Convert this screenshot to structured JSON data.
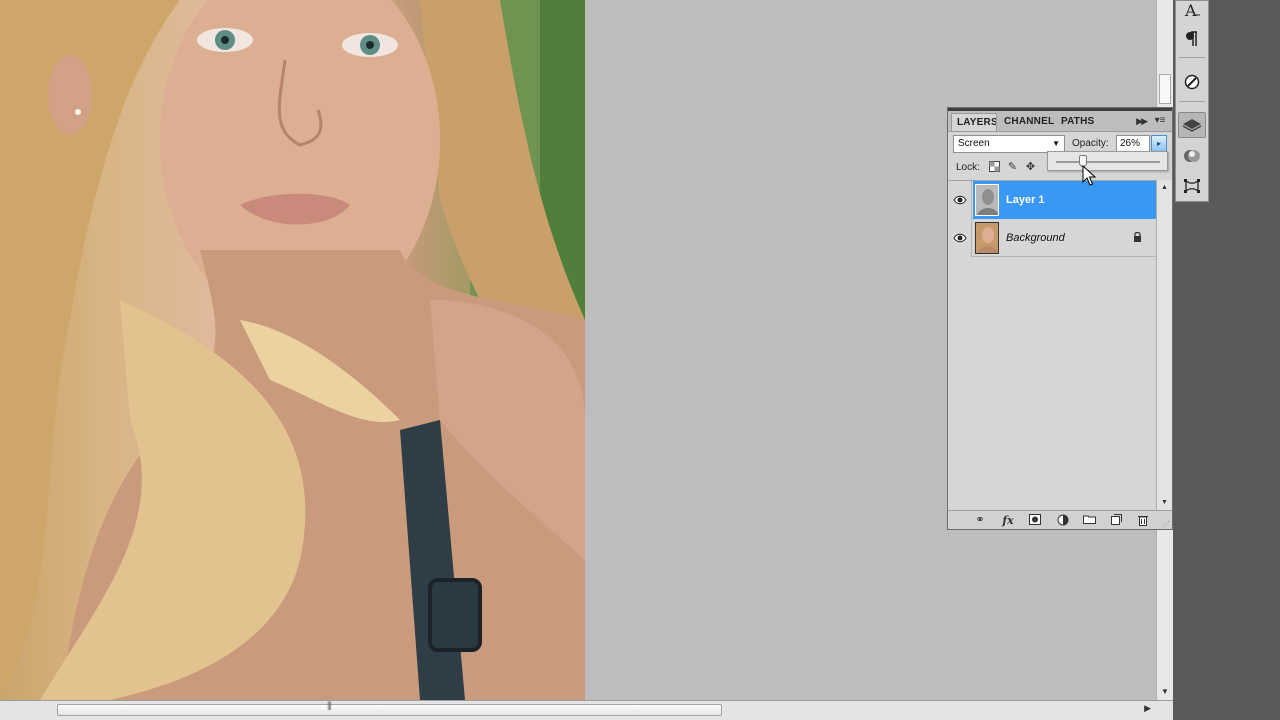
{
  "panel": {
    "tabs": [
      {
        "label": "LAYERS",
        "active": true
      },
      {
        "label": "CHANNELS",
        "active": false
      },
      {
        "label": "PATHS",
        "active": false
      }
    ],
    "blend_mode": "Screen",
    "opacity_label": "Opacity:",
    "opacity_value": "26%",
    "opacity_fraction": 0.26,
    "lock_label": "Lock:",
    "layers": [
      {
        "name": "Layer 1",
        "visible": true,
        "selected": true,
        "italic": false,
        "locked": false
      },
      {
        "name": "Background",
        "visible": true,
        "selected": false,
        "italic": true,
        "locked": true
      }
    ]
  },
  "colors": {
    "selection": "#3a98f5",
    "workspace": "#bdbdbd",
    "gutter": "#5a5a5a"
  },
  "icons": {
    "tools": [
      "character-icon",
      "paragraph-icon",
      "brush-preset-icon",
      "layers-icon",
      "channels-icon",
      "paths-icon"
    ],
    "footer": [
      "link-layers-icon",
      "fx-icon",
      "add-mask-icon",
      "adjustment-layer-icon",
      "new-group-icon",
      "new-layer-icon",
      "delete-layer-icon"
    ]
  }
}
